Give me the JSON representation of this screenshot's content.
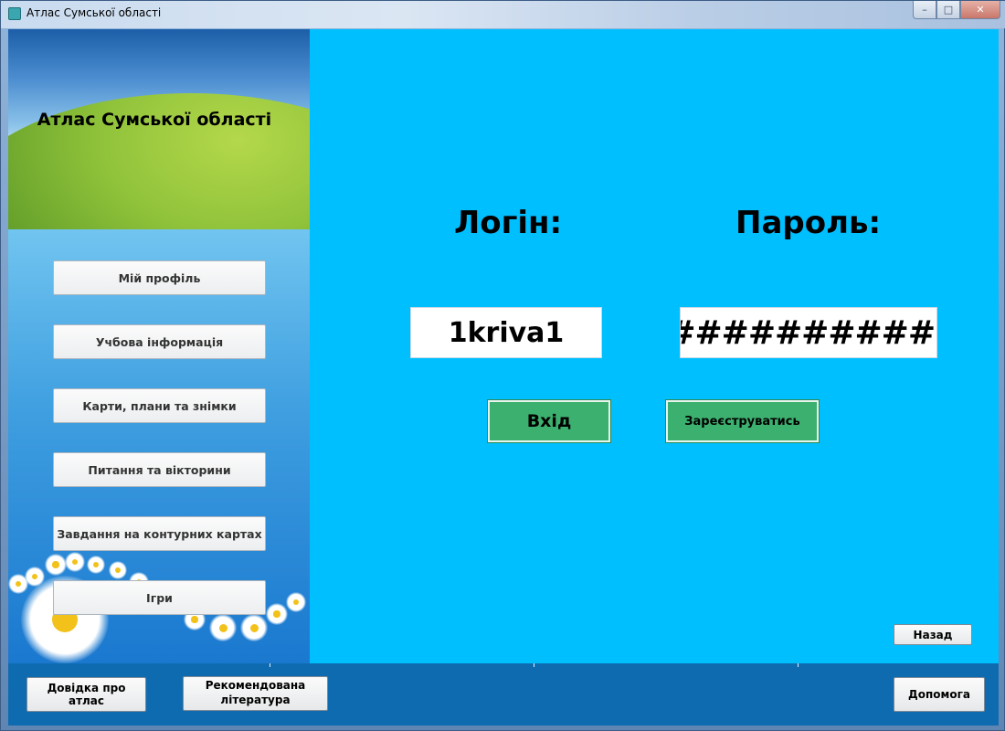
{
  "window": {
    "title": "Атлас Сумської області",
    "controls": {
      "minimize": "–",
      "maximize": "□",
      "close": "✕"
    }
  },
  "sidebar": {
    "hero_title": "Атлас Сумської області",
    "items": [
      {
        "label": "Мій профіль"
      },
      {
        "label": "Учбова інформація"
      },
      {
        "label": "Карти, плани та знімки"
      },
      {
        "label": "Питання та вікторини"
      },
      {
        "label": "Завдання на контурних картах"
      },
      {
        "label": "Ігри"
      }
    ]
  },
  "login": {
    "login_label": "Логін:",
    "password_label": "Пароль:",
    "login_value": "1kriva1",
    "password_value": "###########",
    "enter_button": "Вхід",
    "register_button": "Зареєструватись",
    "back_button": "Назад"
  },
  "footer": {
    "about_button": "Довідка про атлас",
    "literature_button": "Рекомендована література",
    "help_button": "Допомога"
  },
  "colors": {
    "main_bg": "#00bfff",
    "footer_bg": "#0e6bb0",
    "button_green": "#3cb06e"
  }
}
